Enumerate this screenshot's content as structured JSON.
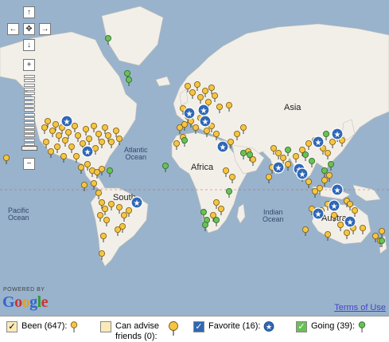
{
  "map": {
    "nav_up": "↑",
    "nav_left": "←",
    "nav_center": "✥",
    "nav_right": "→",
    "nav_down": "↓",
    "zoom_in": "+",
    "zoom_out": "−",
    "labels": {
      "asia": "Asia",
      "africa": "Africa",
      "atlantic_line1": "Atlantic",
      "atlantic_line2": "Ocean",
      "pacific_line1": "Pacific",
      "pacific_line2": "Ocean",
      "indian_line1": "Indian",
      "indian_line2": "Ocean",
      "south_america_fragment": "South",
      "australia_fragment": "Austra"
    },
    "powered_by": "POWERED BY",
    "google_logo": "Google",
    "terms": "Terms of Use",
    "colors": {
      "water": "#99b3cc",
      "land": "#f2efe9",
      "been": "#f5c542",
      "going": "#6bbf59",
      "favorite": "#2f67b5"
    },
    "markers": {
      "been": [
        [
          8,
          198
        ],
        [
          56,
          160
        ],
        [
          60,
          152
        ],
        [
          66,
          164
        ],
        [
          70,
          156
        ],
        [
          74,
          170
        ],
        [
          78,
          160
        ],
        [
          82,
          176
        ],
        [
          86,
          166
        ],
        [
          90,
          184
        ],
        [
          94,
          158
        ],
        [
          98,
          170
        ],
        [
          104,
          180
        ],
        [
          108,
          162
        ],
        [
          112,
          174
        ],
        [
          118,
          158
        ],
        [
          120,
          186
        ],
        [
          124,
          168
        ],
        [
          128,
          178
        ],
        [
          132,
          160
        ],
        [
          136,
          170
        ],
        [
          140,
          178
        ],
        [
          146,
          164
        ],
        [
          150,
          174
        ],
        [
          58,
          178
        ],
        [
          64,
          190
        ],
        [
          72,
          184
        ],
        [
          80,
          196
        ],
        [
          96,
          196
        ],
        [
          102,
          210
        ],
        [
          110,
          206
        ],
        [
          116,
          214
        ],
        [
          122,
          216
        ],
        [
          128,
          212
        ],
        [
          106,
          232
        ],
        [
          118,
          230
        ],
        [
          124,
          242
        ],
        [
          128,
          254
        ],
        [
          132,
          262
        ],
        [
          126,
          270
        ],
        [
          134,
          276
        ],
        [
          130,
          296
        ],
        [
          128,
          318
        ],
        [
          140,
          256
        ],
        [
          150,
          260
        ],
        [
          156,
          270
        ],
        [
          162,
          264
        ],
        [
          148,
          288
        ],
        [
          154,
          284
        ],
        [
          236,
          108
        ],
        [
          242,
          116
        ],
        [
          248,
          106
        ],
        [
          252,
          122
        ],
        [
          258,
          114
        ],
        [
          262,
          128
        ],
        [
          266,
          110
        ],
        [
          270,
          120
        ],
        [
          276,
          134
        ],
        [
          288,
          132
        ],
        [
          230,
          136
        ],
        [
          236,
          146
        ],
        [
          226,
          160
        ],
        [
          232,
          156
        ],
        [
          240,
          152
        ],
        [
          246,
          160
        ],
        [
          252,
          148
        ],
        [
          260,
          164
        ],
        [
          266,
          158
        ],
        [
          272,
          168
        ],
        [
          222,
          180
        ],
        [
          230,
          172
        ],
        [
          290,
          178
        ],
        [
          298,
          168
        ],
        [
          306,
          160
        ],
        [
          312,
          190
        ],
        [
          318,
          200
        ],
        [
          292,
          222
        ],
        [
          284,
          214
        ],
        [
          272,
          254
        ],
        [
          278,
          262
        ],
        [
          268,
          270
        ],
        [
          344,
          186
        ],
        [
          350,
          192
        ],
        [
          356,
          198
        ],
        [
          362,
          206
        ],
        [
          338,
          222
        ],
        [
          342,
          210
        ],
        [
          372,
          196
        ],
        [
          380,
          188
        ],
        [
          388,
          180
        ],
        [
          396,
          176
        ],
        [
          406,
          186
        ],
        [
          412,
          192
        ],
        [
          418,
          178
        ],
        [
          424,
          170
        ],
        [
          430,
          176
        ],
        [
          380,
          220
        ],
        [
          388,
          228
        ],
        [
          396,
          240
        ],
        [
          402,
          236
        ],
        [
          408,
          226
        ],
        [
          414,
          220
        ],
        [
          392,
          262
        ],
        [
          404,
          264
        ],
        [
          412,
          256
        ],
        [
          420,
          270
        ],
        [
          428,
          282
        ],
        [
          436,
          292
        ],
        [
          444,
          286
        ],
        [
          446,
          264
        ],
        [
          436,
          252
        ],
        [
          456,
          286
        ],
        [
          472,
          296
        ],
        [
          480,
          290
        ],
        [
          384,
          288
        ],
        [
          412,
          294
        ],
        [
          440,
          256
        ],
        [
          478,
          302
        ]
      ],
      "going": [
        [
          136,
          48
        ],
        [
          160,
          92
        ],
        [
          162,
          100
        ],
        [
          138,
          214
        ],
        [
          208,
          208
        ],
        [
          232,
          176
        ],
        [
          306,
          192
        ],
        [
          314,
          194
        ],
        [
          288,
          240
        ],
        [
          256,
          266
        ],
        [
          260,
          276
        ],
        [
          272,
          276
        ],
        [
          258,
          282
        ],
        [
          408,
          214
        ],
        [
          416,
          206
        ],
        [
          362,
          188
        ],
        [
          384,
          194
        ],
        [
          392,
          202
        ],
        [
          410,
          168
        ],
        [
          480,
          302
        ]
      ],
      "favorite": [
        [
          84,
          152
        ],
        [
          110,
          190
        ],
        [
          172,
          254
        ],
        [
          238,
          142
        ],
        [
          256,
          138
        ],
        [
          258,
          152
        ],
        [
          280,
          184
        ],
        [
          350,
          210
        ],
        [
          376,
          212
        ],
        [
          380,
          218
        ],
        [
          400,
          178
        ],
        [
          424,
          168
        ],
        [
          424,
          238
        ],
        [
          420,
          258
        ],
        [
          400,
          268
        ],
        [
          440,
          278
        ]
      ]
    }
  },
  "legend": {
    "been_label": "Been (647):",
    "advise_label": "Can advise friends (0):",
    "favorite_label": "Favorite (16):",
    "going_label": "Going (39):",
    "been_checked": "✓",
    "advise_checked": "",
    "favorite_checked": "✓",
    "going_checked": "✓"
  }
}
